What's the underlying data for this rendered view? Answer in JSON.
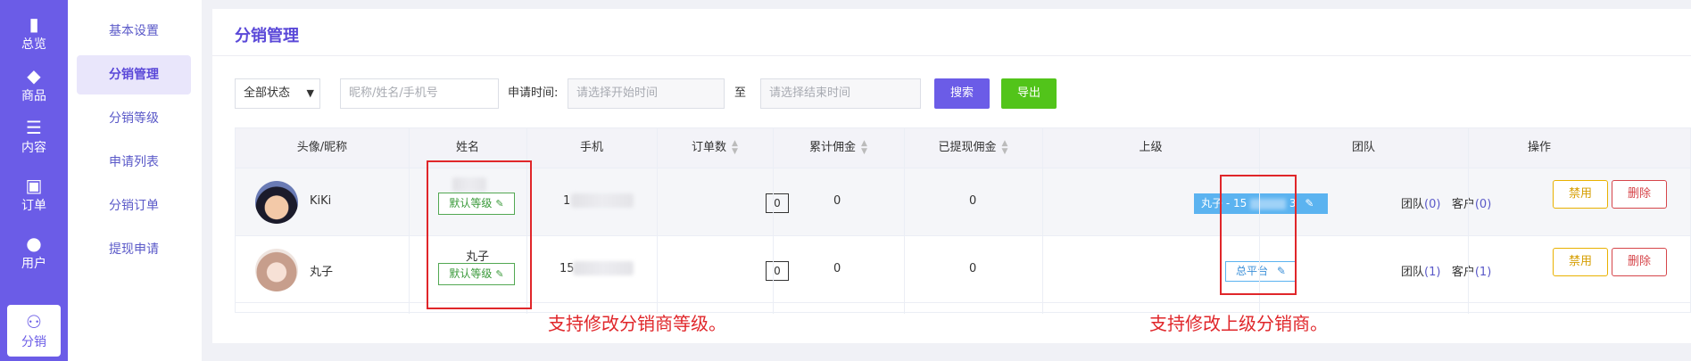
{
  "rail": [
    {
      "label": "总览",
      "icon": "bar-chart-icon",
      "glyph": "▮"
    },
    {
      "label": "商品",
      "icon": "shopping-bag-icon",
      "glyph": "◆"
    },
    {
      "label": "内容",
      "icon": "list-icon",
      "glyph": "☰"
    },
    {
      "label": "订单",
      "icon": "wallet-icon",
      "glyph": "▣"
    },
    {
      "label": "用户",
      "icon": "user-icon",
      "glyph": "●"
    },
    {
      "label": "分销",
      "icon": "users-icon",
      "glyph": "⚇"
    }
  ],
  "subnav": [
    "基本设置",
    "分销管理",
    "分销等级",
    "申请列表",
    "分销订单",
    "提现申请"
  ],
  "page": {
    "title": "分销管理"
  },
  "filter": {
    "status": "全部状态",
    "keyword_placeholder": "昵称/姓名/手机号",
    "apply_time_label": "申请时间:",
    "start_placeholder": "请选择开始时间",
    "to": "至",
    "end_placeholder": "请选择结束时间",
    "search": "搜索",
    "export": "导出"
  },
  "table": {
    "columns": [
      "头像/昵称",
      "姓名",
      "手机",
      "订单数",
      "累计佣金",
      "已提现佣金",
      "上级",
      "团队",
      "操作"
    ],
    "rows": [
      {
        "nickname": "KiKi",
        "name": "",
        "level": "默认等级",
        "phone": "1",
        "orders": "0",
        "total_commission": "0",
        "withdrawn": "0",
        "parent": "丸子 - 15",
        "parent_tail": "3",
        "team_label": "团队",
        "team_count": "(0)",
        "customer_label": "客户",
        "customer_count": "(0)",
        "disable": "禁用",
        "delete": "删除"
      },
      {
        "nickname": "丸子",
        "name": "丸子",
        "level": "默认等级",
        "phone": "15",
        "orders": "0",
        "total_commission": "0",
        "withdrawn": "0",
        "parent": "总平台",
        "parent_tail": "",
        "team_label": "团队",
        "team_count": "(1)",
        "customer_label": "客户",
        "customer_count": "(1)",
        "disable": "禁用",
        "delete": "删除"
      }
    ]
  },
  "annotations": {
    "level_note": "支持修改分销商等级。",
    "parent_note": "支持修改上级分销商。"
  },
  "colors": {
    "brand": "#6b5ce7",
    "export": "#52c41a",
    "annotation": "#e0262a"
  }
}
